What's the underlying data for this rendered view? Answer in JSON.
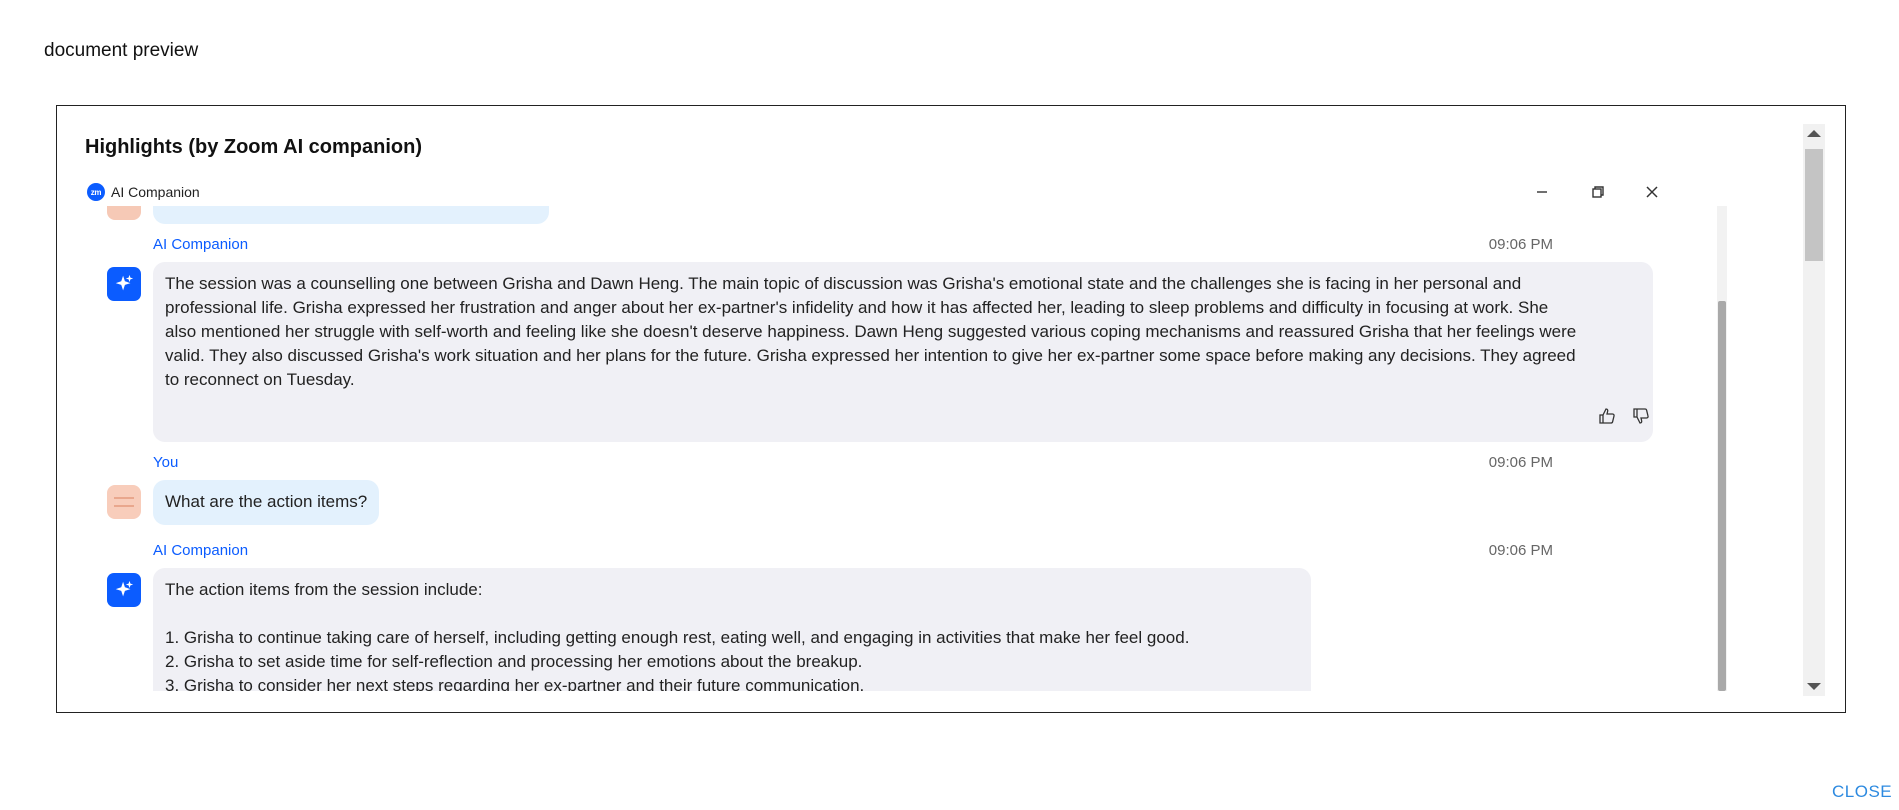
{
  "dialog": {
    "title": "document preview",
    "close_label": "CLOSE"
  },
  "highlights": {
    "title": "Highlights (by Zoom AI companion)"
  },
  "window": {
    "logo_text": "zm",
    "name": "AI Companion"
  },
  "messages": [
    {
      "sender": "AI Companion",
      "time": "09:06 PM",
      "text": "The session was a counselling one between Grisha and Dawn Heng. The main topic of discussion was Grisha's emotional state and the challenges she is facing in her personal and\nprofessional life. Grisha expressed her frustration and anger about her ex-partner's infidelity and how it has affected her, leading to sleep problems and difficulty in focusing at work. She\nalso mentioned her struggle with self-worth and feeling like she doesn't deserve happiness. Dawn Heng suggested various coping mechanisms and reassured Grisha that her feelings were\nvalid. They also discussed Grisha's work situation and her plans for the future. Grisha expressed her intention to give her ex-partner some space before making any decisions. They agreed\nto reconnect on Tuesday."
    },
    {
      "sender": "You",
      "time": "09:06 PM",
      "text": "What are the action items?"
    },
    {
      "sender": "AI Companion",
      "time": "09:06 PM",
      "text": "The action items from the session include:\n\n1. Grisha to continue taking care of herself, including getting enough rest, eating well, and engaging in activities that make her feel good.\n2. Grisha to set aside time for self-reflection and processing her emotions about the breakup.\n3. Grisha to consider her next steps regarding her ex-partner and their future communication."
    }
  ],
  "colors": {
    "accent": "#0b5cff",
    "ai_bubble": "#f0f0f5",
    "user_bubble": "#e3f1fd",
    "link": "#2d8ae0"
  }
}
